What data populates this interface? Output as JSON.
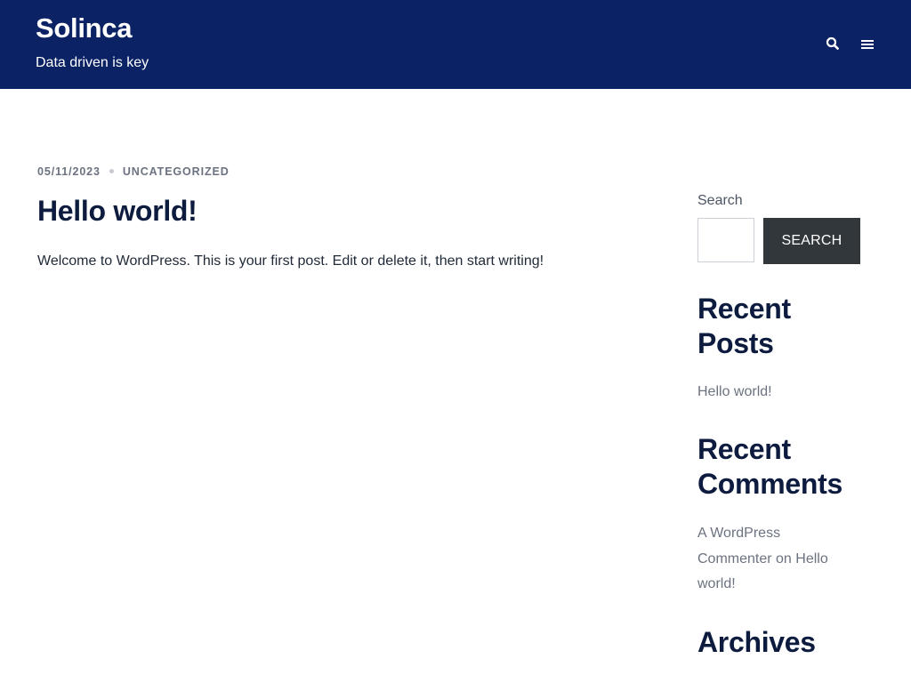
{
  "header": {
    "site_title": "Solinca",
    "tagline": "Data driven is key",
    "background_color": "#0b2265",
    "icons": [
      "search-icon",
      "menu-icon"
    ]
  },
  "post": {
    "date": "05/11/2023",
    "category": "UNCATEGORIZED",
    "title": "Hello world!",
    "excerpt": "Welcome to WordPress. This is your first post. Edit or delete it, then start writing!"
  },
  "sidebar": {
    "search": {
      "label": "Search",
      "input_value": "",
      "button_label": "SEARCH"
    },
    "recent_posts": {
      "title": "Recent Posts",
      "items": [
        "Hello world!"
      ]
    },
    "recent_comments": {
      "title": "Recent Comments",
      "items": [
        {
          "author": "A WordPress Commenter",
          "connector": " on ",
          "post": "Hello world!"
        }
      ]
    },
    "archives": {
      "title": "Archives"
    }
  }
}
